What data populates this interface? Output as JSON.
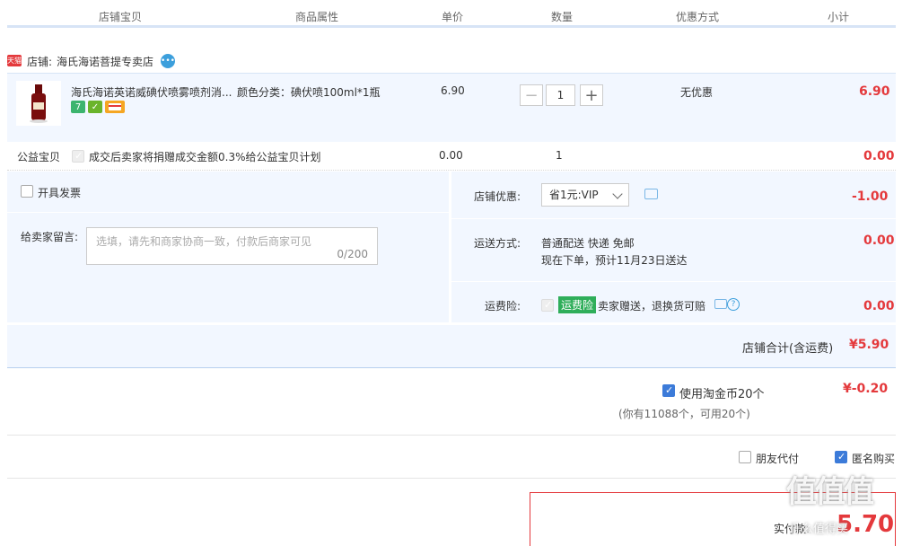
{
  "header": [
    "店铺宝贝",
    "商品属性",
    "单价",
    "数量",
    "优惠方式",
    "小计"
  ],
  "shop": {
    "badge": "天猫",
    "label": "店铺:",
    "name": "海氏海诺菩提专卖店"
  },
  "product": {
    "title": "海氏海诺英诺威碘伏喷雾喷剂消...",
    "attribute": "颜色分类：碘伏喷100ml*1瓶",
    "price": "6.90",
    "quantity": "1",
    "discount": "无优惠",
    "subtotal": "6.90",
    "tags": [
      "7",
      "✓",
      "card"
    ]
  },
  "charity": {
    "label": "公益宝贝",
    "text": "成交后卖家将捐赠成交金额0.3%给公益宝贝计划",
    "price": "0.00",
    "quantity": "1",
    "subtotal": "0.00"
  },
  "invoice": {
    "label": "开具发票"
  },
  "message": {
    "label": "给卖家留言:",
    "placeholder": "选填，请先和商家协商一致，付款后商家可见",
    "counter": "0/200"
  },
  "shop_discount": {
    "label": "店铺优惠:",
    "selected": "省1元:VIP",
    "amount": "-1.00"
  },
  "shipping": {
    "label": "运送方式:",
    "line1": "普通配送 快递 免邮",
    "line2": "现在下单，预计11月23日送达",
    "amount": "0.00"
  },
  "insurance": {
    "label": "运费险:",
    "tag": "运费险",
    "text": "卖家赠送，退换货可赔",
    "amount": "0.00"
  },
  "shop_total": {
    "label": "店铺合计(含运费)",
    "amount": "¥5.90"
  },
  "coins": {
    "label": "使用淘金币20个",
    "amount": "¥-0.20",
    "note": "(你有11088个，可用20个)"
  },
  "options": {
    "friend_pay": "朋友代付",
    "anonymous": "匿名购买"
  },
  "payment": {
    "label": "实付款:",
    "amount": "5.70"
  },
  "watermark": {
    "text": "值值值",
    "subtext": "什么值得买"
  },
  "colors": {
    "accent_red": "#e4393c",
    "blue": "#3c7bd9",
    "panel": "#f2f7ff",
    "line": "#d7e4f6"
  }
}
